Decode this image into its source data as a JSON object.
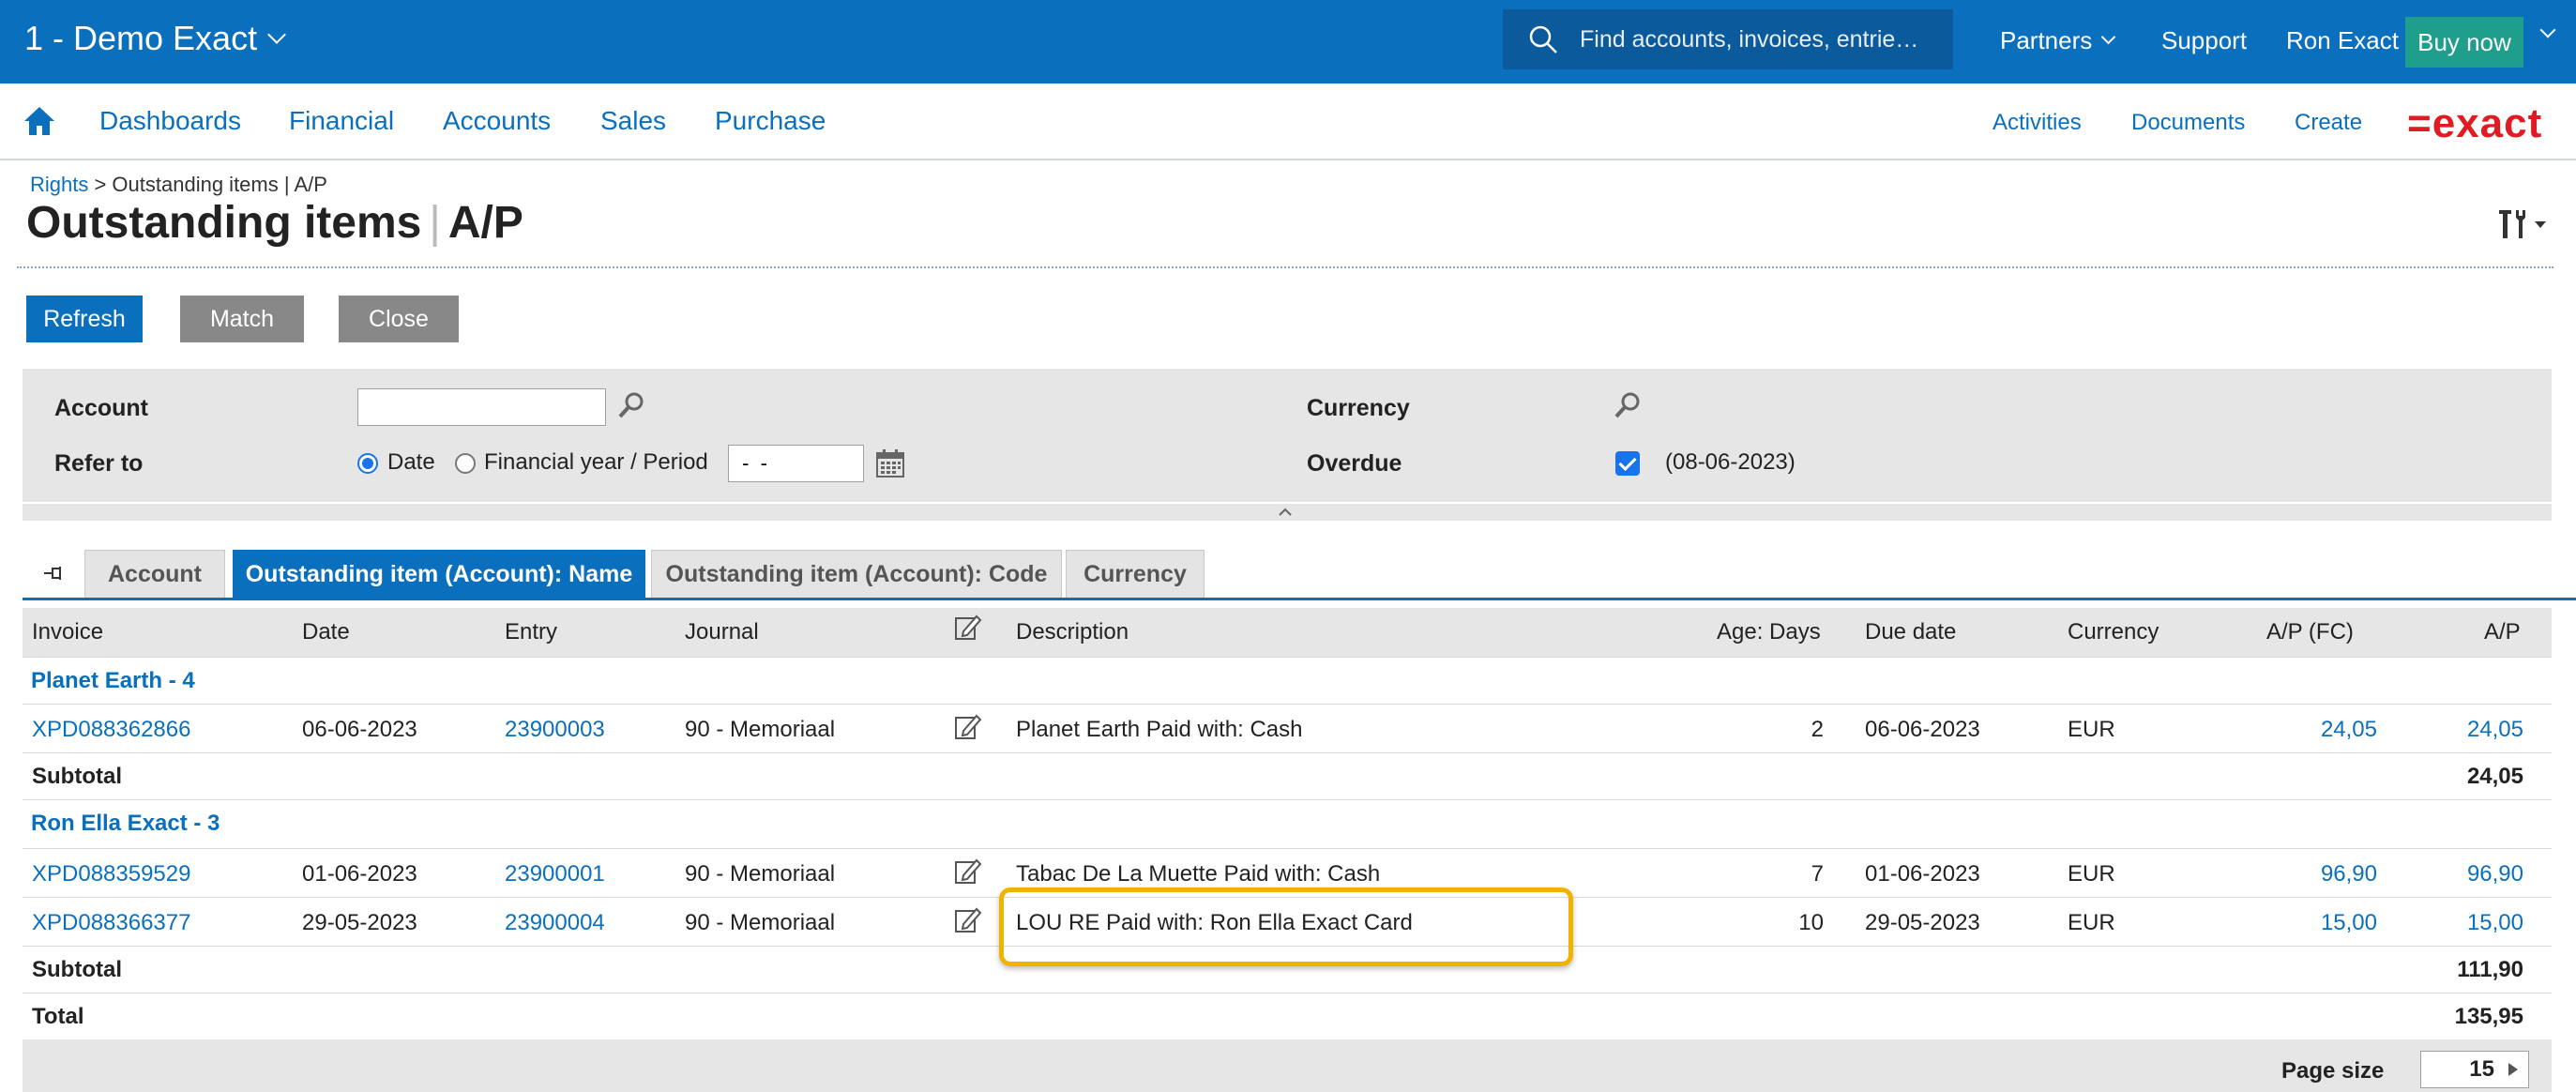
{
  "topbar": {
    "company": "1 - Demo Exact",
    "search_placeholder": "Find accounts, invoices, entrie…",
    "partners": "Partners",
    "support": "Support",
    "user": "Ron Exact",
    "buy_now": "Buy now",
    "bg_color": "#0a6fbd"
  },
  "mainnav": {
    "items": [
      "Dashboards",
      "Financial",
      "Accounts",
      "Sales",
      "Purchase"
    ],
    "right_items": [
      "Activities",
      "Documents",
      "Create"
    ],
    "logo": "=exact"
  },
  "header": {
    "breadcrumb_link": "Rights",
    "breadcrumb_rest": " > Outstanding items | A/P",
    "title_main": "Outstanding items",
    "title_sep": "|",
    "title_sub": "A/P"
  },
  "buttons": {
    "refresh": "Refresh",
    "match": "Match",
    "close": "Close"
  },
  "filter": {
    "account_label": "Account",
    "account_value": "",
    "refer_label": "Refer to",
    "radio_date": "Date",
    "radio_period": "Financial year / Period",
    "period_value": " -  -",
    "currency_label": "Currency",
    "overdue_label": "Overdue",
    "overdue_date": "(08-06-2023)"
  },
  "tabs": [
    "Account",
    "Outstanding item (Account): Name",
    "Outstanding item (Account): Code",
    "Currency"
  ],
  "table": {
    "columns": [
      "Invoice",
      "Date",
      "Entry",
      "Journal",
      "Description",
      "Age: Days",
      "Due date",
      "Currency",
      "A/P (FC)",
      "A/P"
    ],
    "groups": [
      {
        "name": "Planet Earth - 4",
        "rows": [
          {
            "invoice": "XPD088362866",
            "date": "06-06-2023",
            "entry": "23900003",
            "journal": "90 - Memoriaal",
            "description": "Planet Earth Paid with: Cash",
            "age": "2",
            "due": "06-06-2023",
            "currency": "EUR",
            "ap_fc": "24,05",
            "ap": "24,05"
          }
        ],
        "subtotal_label": "Subtotal",
        "subtotal": "24,05"
      },
      {
        "name": "Ron Ella Exact - 3",
        "rows": [
          {
            "invoice": "XPD088359529",
            "date": "01-06-2023",
            "entry": "23900001",
            "journal": "90 - Memoriaal",
            "description": "Tabac De La Muette Paid with: Cash",
            "age": "7",
            "due": "01-06-2023",
            "currency": "EUR",
            "ap_fc": "96,90",
            "ap": "96,90"
          },
          {
            "invoice": "XPD088366377",
            "date": "29-05-2023",
            "entry": "23900004",
            "journal": "90 - Memoriaal",
            "description": "LOU RE Paid with: Ron Ella Exact Card",
            "age": "10",
            "due": "29-05-2023",
            "currency": "EUR",
            "ap_fc": "15,00",
            "ap": "15,00"
          }
        ],
        "subtotal_label": "Subtotal",
        "subtotal": "111,90"
      }
    ],
    "total_label": "Total",
    "total": "135,95"
  },
  "footer": {
    "page_size_label": "Page size",
    "page_size": "15"
  },
  "colors": {
    "highlight": "#f0b400",
    "link": "#0a6fbd",
    "buy_now": "#1f9e8b",
    "logo": "#e01b22"
  }
}
